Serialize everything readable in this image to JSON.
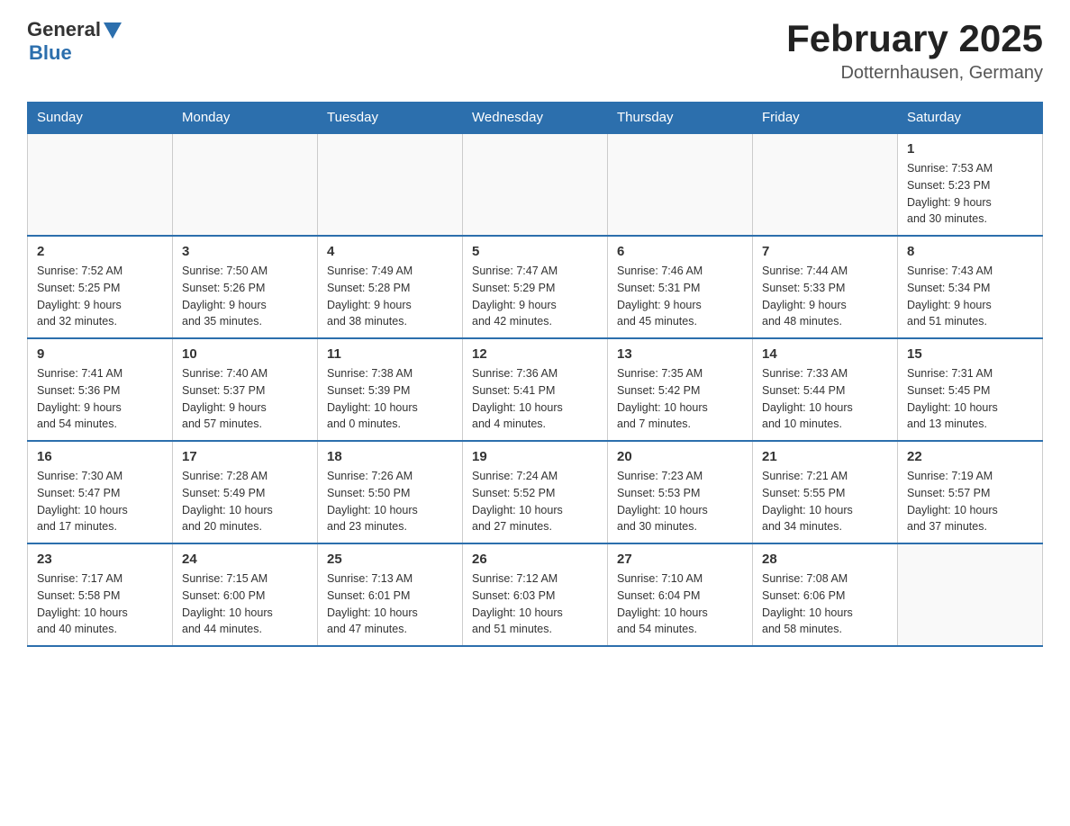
{
  "header": {
    "logo_general": "General",
    "logo_triangle": "▲",
    "logo_blue": "Blue",
    "month_title": "February 2025",
    "location": "Dotternhausen, Germany"
  },
  "weekdays": [
    "Sunday",
    "Monday",
    "Tuesday",
    "Wednesday",
    "Thursday",
    "Friday",
    "Saturday"
  ],
  "weeks": [
    [
      {
        "day": "",
        "info": ""
      },
      {
        "day": "",
        "info": ""
      },
      {
        "day": "",
        "info": ""
      },
      {
        "day": "",
        "info": ""
      },
      {
        "day": "",
        "info": ""
      },
      {
        "day": "",
        "info": ""
      },
      {
        "day": "1",
        "info": "Sunrise: 7:53 AM\nSunset: 5:23 PM\nDaylight: 9 hours\nand 30 minutes."
      }
    ],
    [
      {
        "day": "2",
        "info": "Sunrise: 7:52 AM\nSunset: 5:25 PM\nDaylight: 9 hours\nand 32 minutes."
      },
      {
        "day": "3",
        "info": "Sunrise: 7:50 AM\nSunset: 5:26 PM\nDaylight: 9 hours\nand 35 minutes."
      },
      {
        "day": "4",
        "info": "Sunrise: 7:49 AM\nSunset: 5:28 PM\nDaylight: 9 hours\nand 38 minutes."
      },
      {
        "day": "5",
        "info": "Sunrise: 7:47 AM\nSunset: 5:29 PM\nDaylight: 9 hours\nand 42 minutes."
      },
      {
        "day": "6",
        "info": "Sunrise: 7:46 AM\nSunset: 5:31 PM\nDaylight: 9 hours\nand 45 minutes."
      },
      {
        "day": "7",
        "info": "Sunrise: 7:44 AM\nSunset: 5:33 PM\nDaylight: 9 hours\nand 48 minutes."
      },
      {
        "day": "8",
        "info": "Sunrise: 7:43 AM\nSunset: 5:34 PM\nDaylight: 9 hours\nand 51 minutes."
      }
    ],
    [
      {
        "day": "9",
        "info": "Sunrise: 7:41 AM\nSunset: 5:36 PM\nDaylight: 9 hours\nand 54 minutes."
      },
      {
        "day": "10",
        "info": "Sunrise: 7:40 AM\nSunset: 5:37 PM\nDaylight: 9 hours\nand 57 minutes."
      },
      {
        "day": "11",
        "info": "Sunrise: 7:38 AM\nSunset: 5:39 PM\nDaylight: 10 hours\nand 0 minutes."
      },
      {
        "day": "12",
        "info": "Sunrise: 7:36 AM\nSunset: 5:41 PM\nDaylight: 10 hours\nand 4 minutes."
      },
      {
        "day": "13",
        "info": "Sunrise: 7:35 AM\nSunset: 5:42 PM\nDaylight: 10 hours\nand 7 minutes."
      },
      {
        "day": "14",
        "info": "Sunrise: 7:33 AM\nSunset: 5:44 PM\nDaylight: 10 hours\nand 10 minutes."
      },
      {
        "day": "15",
        "info": "Sunrise: 7:31 AM\nSunset: 5:45 PM\nDaylight: 10 hours\nand 13 minutes."
      }
    ],
    [
      {
        "day": "16",
        "info": "Sunrise: 7:30 AM\nSunset: 5:47 PM\nDaylight: 10 hours\nand 17 minutes."
      },
      {
        "day": "17",
        "info": "Sunrise: 7:28 AM\nSunset: 5:49 PM\nDaylight: 10 hours\nand 20 minutes."
      },
      {
        "day": "18",
        "info": "Sunrise: 7:26 AM\nSunset: 5:50 PM\nDaylight: 10 hours\nand 23 minutes."
      },
      {
        "day": "19",
        "info": "Sunrise: 7:24 AM\nSunset: 5:52 PM\nDaylight: 10 hours\nand 27 minutes."
      },
      {
        "day": "20",
        "info": "Sunrise: 7:23 AM\nSunset: 5:53 PM\nDaylight: 10 hours\nand 30 minutes."
      },
      {
        "day": "21",
        "info": "Sunrise: 7:21 AM\nSunset: 5:55 PM\nDaylight: 10 hours\nand 34 minutes."
      },
      {
        "day": "22",
        "info": "Sunrise: 7:19 AM\nSunset: 5:57 PM\nDaylight: 10 hours\nand 37 minutes."
      }
    ],
    [
      {
        "day": "23",
        "info": "Sunrise: 7:17 AM\nSunset: 5:58 PM\nDaylight: 10 hours\nand 40 minutes."
      },
      {
        "day": "24",
        "info": "Sunrise: 7:15 AM\nSunset: 6:00 PM\nDaylight: 10 hours\nand 44 minutes."
      },
      {
        "day": "25",
        "info": "Sunrise: 7:13 AM\nSunset: 6:01 PM\nDaylight: 10 hours\nand 47 minutes."
      },
      {
        "day": "26",
        "info": "Sunrise: 7:12 AM\nSunset: 6:03 PM\nDaylight: 10 hours\nand 51 minutes."
      },
      {
        "day": "27",
        "info": "Sunrise: 7:10 AM\nSunset: 6:04 PM\nDaylight: 10 hours\nand 54 minutes."
      },
      {
        "day": "28",
        "info": "Sunrise: 7:08 AM\nSunset: 6:06 PM\nDaylight: 10 hours\nand 58 minutes."
      },
      {
        "day": "",
        "info": ""
      }
    ]
  ]
}
